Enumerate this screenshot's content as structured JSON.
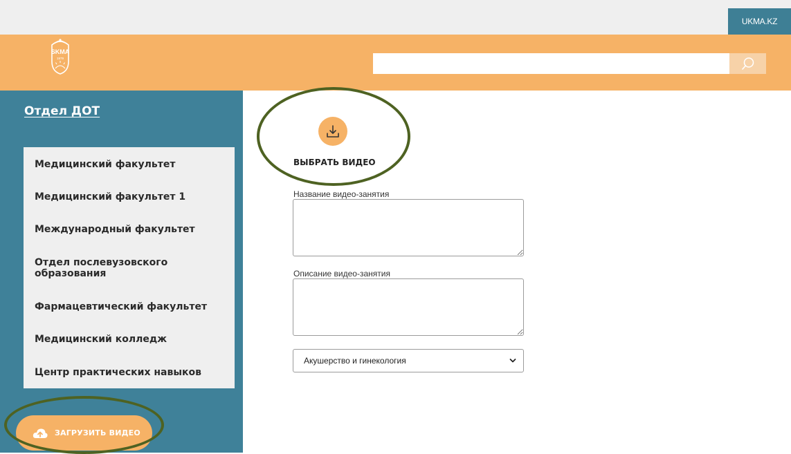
{
  "topbar": {
    "site_link": "UKMA.KZ"
  },
  "header": {
    "logo": {
      "icon": "skma-logo-icon",
      "text": "SKMA",
      "year": "1979"
    },
    "search": {
      "placeholder": "",
      "icon": "search-icon"
    }
  },
  "sidebar": {
    "title": "Отдел ДОТ",
    "items": [
      {
        "label": "Медицинский факультет"
      },
      {
        "label": "Медицинский факультет 1"
      },
      {
        "label": "Международный факультет"
      },
      {
        "label": "Отдел послевузовского образования"
      },
      {
        "label": "Фармацевтический факультет"
      },
      {
        "label": "Медицинский колледж"
      },
      {
        "label": "Центр практических навыков"
      }
    ],
    "upload_button": {
      "label": "ЗАГРУЗИТЬ ВИДЕО",
      "icon": "cloud-upload-icon"
    }
  },
  "main": {
    "pick_video": {
      "label": "ВЫБРАТЬ ВИДЕО",
      "icon": "download-icon"
    },
    "title_field": {
      "label": "Название видео-занятия",
      "value": ""
    },
    "description_field": {
      "label": "Описание видео-занятия",
      "value": ""
    },
    "category_select": {
      "value": "Акушерство и гинекология",
      "icon": "chevron-down-icon"
    }
  },
  "colors": {
    "accent": "#f6b266",
    "sidebar": "#3f8199",
    "highlight_ring": "#4e6222"
  }
}
